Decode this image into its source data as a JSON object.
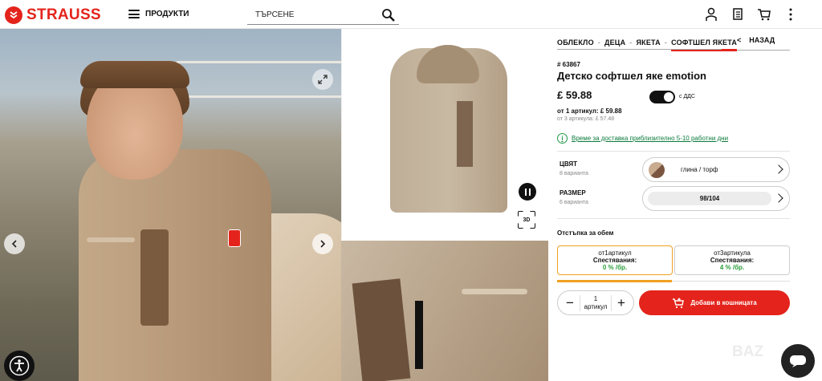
{
  "header": {
    "brand": "STRAUSS",
    "menu_label": "ПРОДУКТИ",
    "search_placeholder": "ТЪРСЕНЕ",
    "icons": [
      "account-icon",
      "wishlist-icon",
      "cart-icon",
      "more-icon"
    ]
  },
  "breadcrumb": {
    "items": [
      "ОБЛЕКЛО",
      "ДЕЦА",
      "ЯКЕТА",
      "СОФТШЕЛ ЯКЕТА"
    ],
    "back_label": "НАЗАД",
    "back_symbol": "<"
  },
  "product": {
    "sku": "# 63867",
    "title": "Детско софтшел яке emotion",
    "price": "£ 59.88",
    "vat_label": "с ДДС",
    "price_tier1": "от 1 артикул: £ 59.88",
    "price_tier3": "от 3 артикула: £ 57.48",
    "delivery_text": "Време за доставка приблизително 5-10 работни дни"
  },
  "options": {
    "color_label": "ЦВЯТ",
    "color_count": "8 варианта",
    "color_value": "глина / торф",
    "size_label": "РАЗМЕР",
    "size_count": "6 варианта",
    "size_value": "98/104"
  },
  "discount": {
    "title": "Отстъпка за обем",
    "tiers": [
      {
        "qty": "от1артикул",
        "savings_label": "Спестявания:",
        "pct": "0 % /бр."
      },
      {
        "qty": "от3артикула",
        "savings_label": "Спестявания:",
        "pct": "4 % /бр."
      }
    ]
  },
  "cart": {
    "qty": "1",
    "qty_unit": "артикул",
    "minus": "−",
    "plus": "+",
    "add_label": "Добави в кошницата"
  },
  "gallery": {
    "badge_3d": "3D"
  },
  "watermark": "BAZ"
}
